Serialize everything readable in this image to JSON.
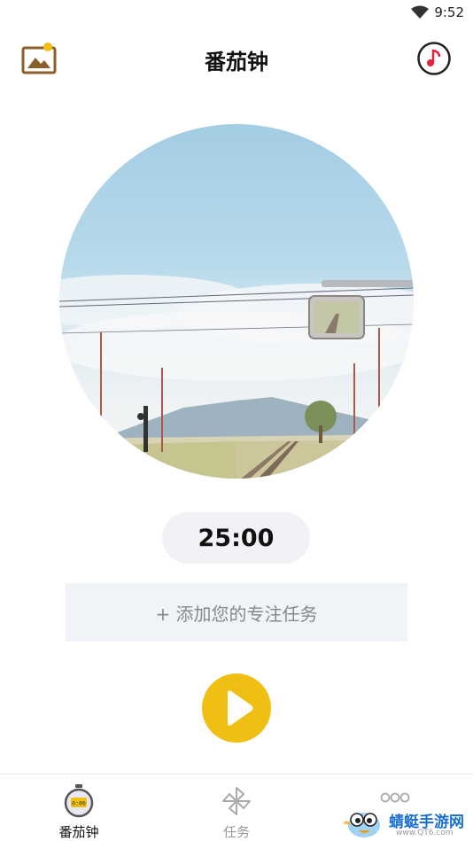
{
  "status_bar": {
    "time": "9:52"
  },
  "app_bar": {
    "title": "番茄钟",
    "left_icon": "image-icon",
    "right_icon": "music-note-icon"
  },
  "cover": {
    "icon": "cover-photo-railway"
  },
  "timer": {
    "value": "25:00"
  },
  "task": {
    "placeholder": "+ 添加您的专注任务"
  },
  "play": {
    "icon": "play-icon",
    "color": "#efbf14"
  },
  "bottom_nav": {
    "items": [
      {
        "label": "番茄钟",
        "icon": "stopwatch-icon",
        "active": true
      },
      {
        "label": "任务",
        "icon": "pinwheel-icon",
        "active": false
      },
      {
        "label": "",
        "icon": "more-dots-icon",
        "active": false
      }
    ]
  },
  "watermark": {
    "text": "蜻蜓手游网",
    "url": "www.QT6.com"
  },
  "colors": {
    "accent": "#efbf14",
    "icon_brown": "#8b5e2a",
    "pill_bg": "#f0f2f6"
  }
}
